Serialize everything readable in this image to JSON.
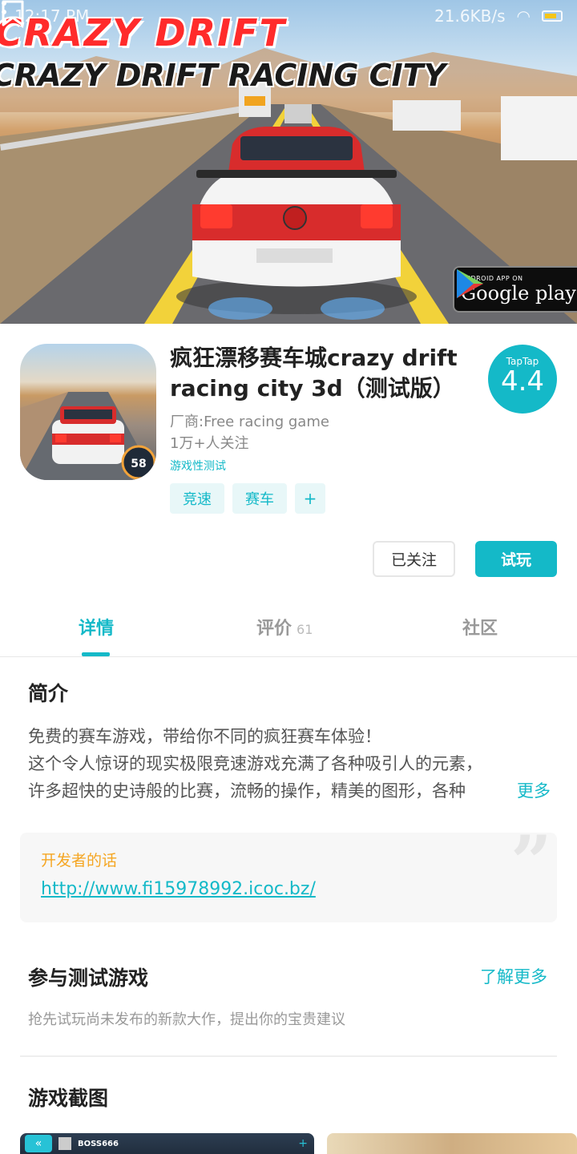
{
  "status_bar": {
    "time": "12:17 PM",
    "speed": "21.6KB/s"
  },
  "hero": {
    "title_line1": "CRAZY DRIFT",
    "title_line2": "CRAZY DRIFT RACING CITY",
    "google_play_small": "ANDROID APP ON",
    "google_play_big": "Google play"
  },
  "app": {
    "title": "疯狂漂移赛车城crazy drift racing city 3d（测试版）",
    "vendor": "厂商:Free racing game",
    "followers": "1万+人关注",
    "stage": "游戏性测试",
    "tags": [
      "竞速",
      "赛车",
      "+"
    ],
    "rating_brand": "TapTap",
    "rating_score": "4.4",
    "follow_button": "已关注",
    "try_button": "试玩"
  },
  "tabs": {
    "detail": "详情",
    "review": "评价",
    "review_count": "61",
    "community": "社区"
  },
  "intro": {
    "title": "简介",
    "line1": "免费的赛车游戏，带给你不同的疯狂赛车体验！",
    "line2": "这个令人惊讶的现实极限竞速游戏充满了各种吸引人的元素，",
    "line3": "许多超快的史诗般的比赛，流畅的操作，精美的图形，各种",
    "more": "更多"
  },
  "developer": {
    "label": "开发者的话",
    "link": "http://www.fi15978992.icoc.bz/"
  },
  "beta": {
    "title": "参与测试游戏",
    "more": "了解更多",
    "desc": "抢先试玩尚未发布的新款大作，提出你的宝贵建议"
  },
  "screenshots": {
    "title": "游戏截图",
    "hud_name": "BOSS666"
  },
  "colors": {
    "accent": "#14b9c8",
    "dev_label": "#f5a623"
  }
}
